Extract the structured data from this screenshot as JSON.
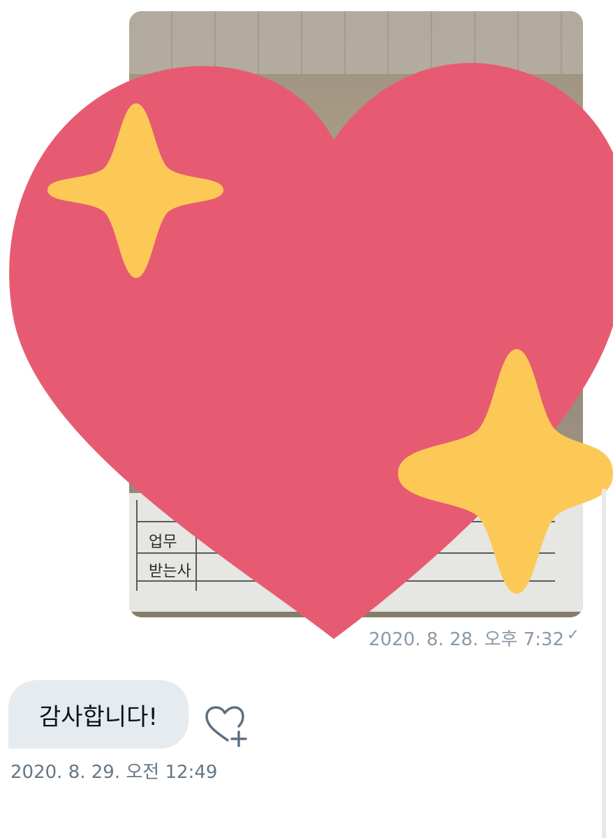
{
  "conversation": {
    "outgoing": {
      "timestamp": "2020. 8. 28. 오후 7:32",
      "status_icon": "check-icon",
      "photo_text": [
        "업무",
        "받는사"
      ]
    },
    "incoming": {
      "message": "감사합니다!",
      "timestamp": "2020. 8. 29. 오전 12:49",
      "reaction_button_icon": "heart-plus-icon"
    }
  },
  "reaction": {
    "emoji": "sparkling-heart",
    "colors": {
      "heart": "#e75b72",
      "sparkle": "#fcc956"
    }
  }
}
